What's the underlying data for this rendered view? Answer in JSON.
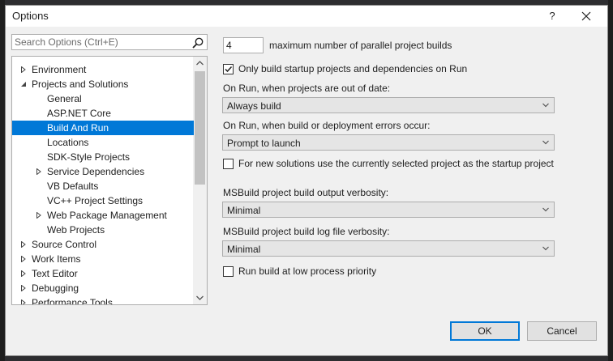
{
  "window": {
    "title": "Options",
    "help_label": "?"
  },
  "search": {
    "placeholder": "Search Options (Ctrl+E)",
    "value": ""
  },
  "tree": {
    "items": [
      {
        "label": "Environment",
        "expander": "collapsed",
        "indent": 0
      },
      {
        "label": "Projects and Solutions",
        "expander": "expanded",
        "indent": 0
      },
      {
        "label": "General",
        "expander": "none",
        "indent": 1
      },
      {
        "label": "ASP.NET Core",
        "expander": "none",
        "indent": 1
      },
      {
        "label": "Build And Run",
        "expander": "none",
        "indent": 1,
        "selected": true
      },
      {
        "label": "Locations",
        "expander": "none",
        "indent": 1
      },
      {
        "label": "SDK-Style Projects",
        "expander": "none",
        "indent": 1
      },
      {
        "label": "Service Dependencies",
        "expander": "collapsed",
        "indent": 1
      },
      {
        "label": "VB Defaults",
        "expander": "none",
        "indent": 1
      },
      {
        "label": "VC++ Project Settings",
        "expander": "none",
        "indent": 1
      },
      {
        "label": "Web Package Management",
        "expander": "collapsed",
        "indent": 1
      },
      {
        "label": "Web Projects",
        "expander": "none",
        "indent": 1
      },
      {
        "label": "Source Control",
        "expander": "collapsed",
        "indent": 0
      },
      {
        "label": "Work Items",
        "expander": "collapsed",
        "indent": 0
      },
      {
        "label": "Text Editor",
        "expander": "collapsed",
        "indent": 0
      },
      {
        "label": "Debugging",
        "expander": "collapsed",
        "indent": 0
      },
      {
        "label": "Performance Tools",
        "expander": "collapsed",
        "indent": 0
      }
    ]
  },
  "settings": {
    "parallel_builds": {
      "value": "4",
      "label": "maximum number of parallel project builds"
    },
    "only_startup": {
      "checked": true,
      "label": "Only build startup projects and dependencies on Run"
    },
    "out_of_date": {
      "label": "On Run, when projects are out of date:",
      "value": "Always build"
    },
    "build_errors": {
      "label": "On Run, when build or deployment errors occur:",
      "value": "Prompt to launch"
    },
    "new_solutions": {
      "checked": false,
      "label": "For new solutions use the currently selected project as the startup project"
    },
    "output_verbosity": {
      "label": "MSBuild project build output verbosity:",
      "value": "Minimal"
    },
    "log_verbosity": {
      "label": "MSBuild project build log file verbosity:",
      "value": "Minimal"
    },
    "low_priority": {
      "checked": false,
      "label": "Run build at low process priority"
    }
  },
  "buttons": {
    "ok": "OK",
    "cancel": "Cancel"
  },
  "colors": {
    "accent": "#0078d7",
    "selection_text": "#ffffff"
  }
}
